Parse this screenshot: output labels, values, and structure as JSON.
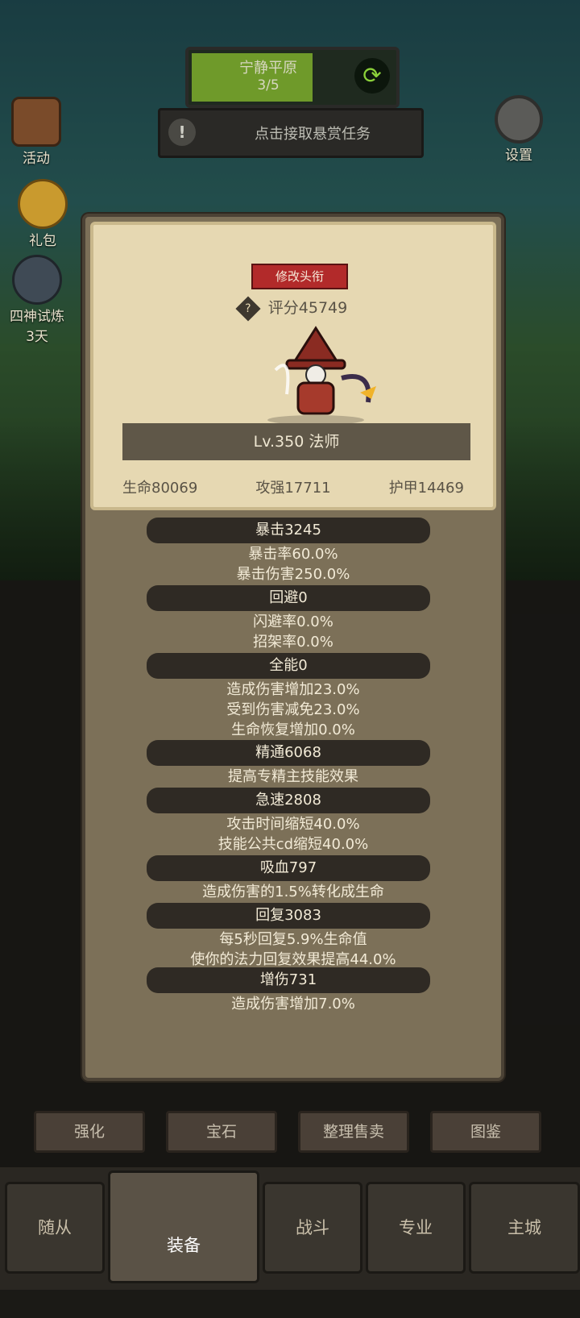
{
  "top_banner": {
    "title": "宁静平原",
    "progress": "3/5",
    "refresh_icon": "refresh-icon"
  },
  "bounty": {
    "label": "点击接取悬赏任务"
  },
  "left_menu": [
    {
      "label": "活动",
      "icon": "calendar-icon"
    },
    {
      "label": "礼包",
      "icon": "gift-icon"
    },
    {
      "label": "四神试炼",
      "sub": "3天",
      "icon": "trial-icon"
    }
  ],
  "settings": {
    "label": "设置",
    "icon": "gear-icon"
  },
  "modal": {
    "rename_label": "修改头衔",
    "score": "评分45749",
    "help_icon": "question-icon",
    "level_class": "Lv.350 法师",
    "core_stats": [
      "生命80069",
      "攻强17711",
      "护甲14469"
    ],
    "sections": [
      {
        "title": "暴击3245",
        "lines": [
          "暴击率60.0%",
          "暴击伤害250.0%"
        ]
      },
      {
        "title": "回避0",
        "lines": [
          "闪避率0.0%",
          "招架率0.0%"
        ]
      },
      {
        "title": "全能0",
        "lines": [
          "造成伤害增加23.0%",
          "受到伤害减免23.0%",
          "生命恢复增加0.0%"
        ]
      },
      {
        "title": "精通6068",
        "lines": [
          "提高专精主技能效果"
        ]
      },
      {
        "title": "急速2808",
        "lines": [
          "攻击时间缩短40.0%",
          "技能公共cd缩短40.0%"
        ]
      },
      {
        "title": "吸血797",
        "lines": [
          "造成伤害的1.5%转化成生命"
        ]
      },
      {
        "title": "回复3083",
        "lines": [
          "每5秒回复5.9%生命值",
          "使你的法力回复效果提高44.0%"
        ]
      },
      {
        "title": "增伤731",
        "lines": [
          "造成伤害增加7.0%"
        ]
      }
    ]
  },
  "bottom_actions": [
    "强化",
    "宝石",
    "整理售卖",
    "图鉴"
  ],
  "nav": [
    "随从",
    "装备",
    "战斗",
    "专业",
    "主城"
  ]
}
